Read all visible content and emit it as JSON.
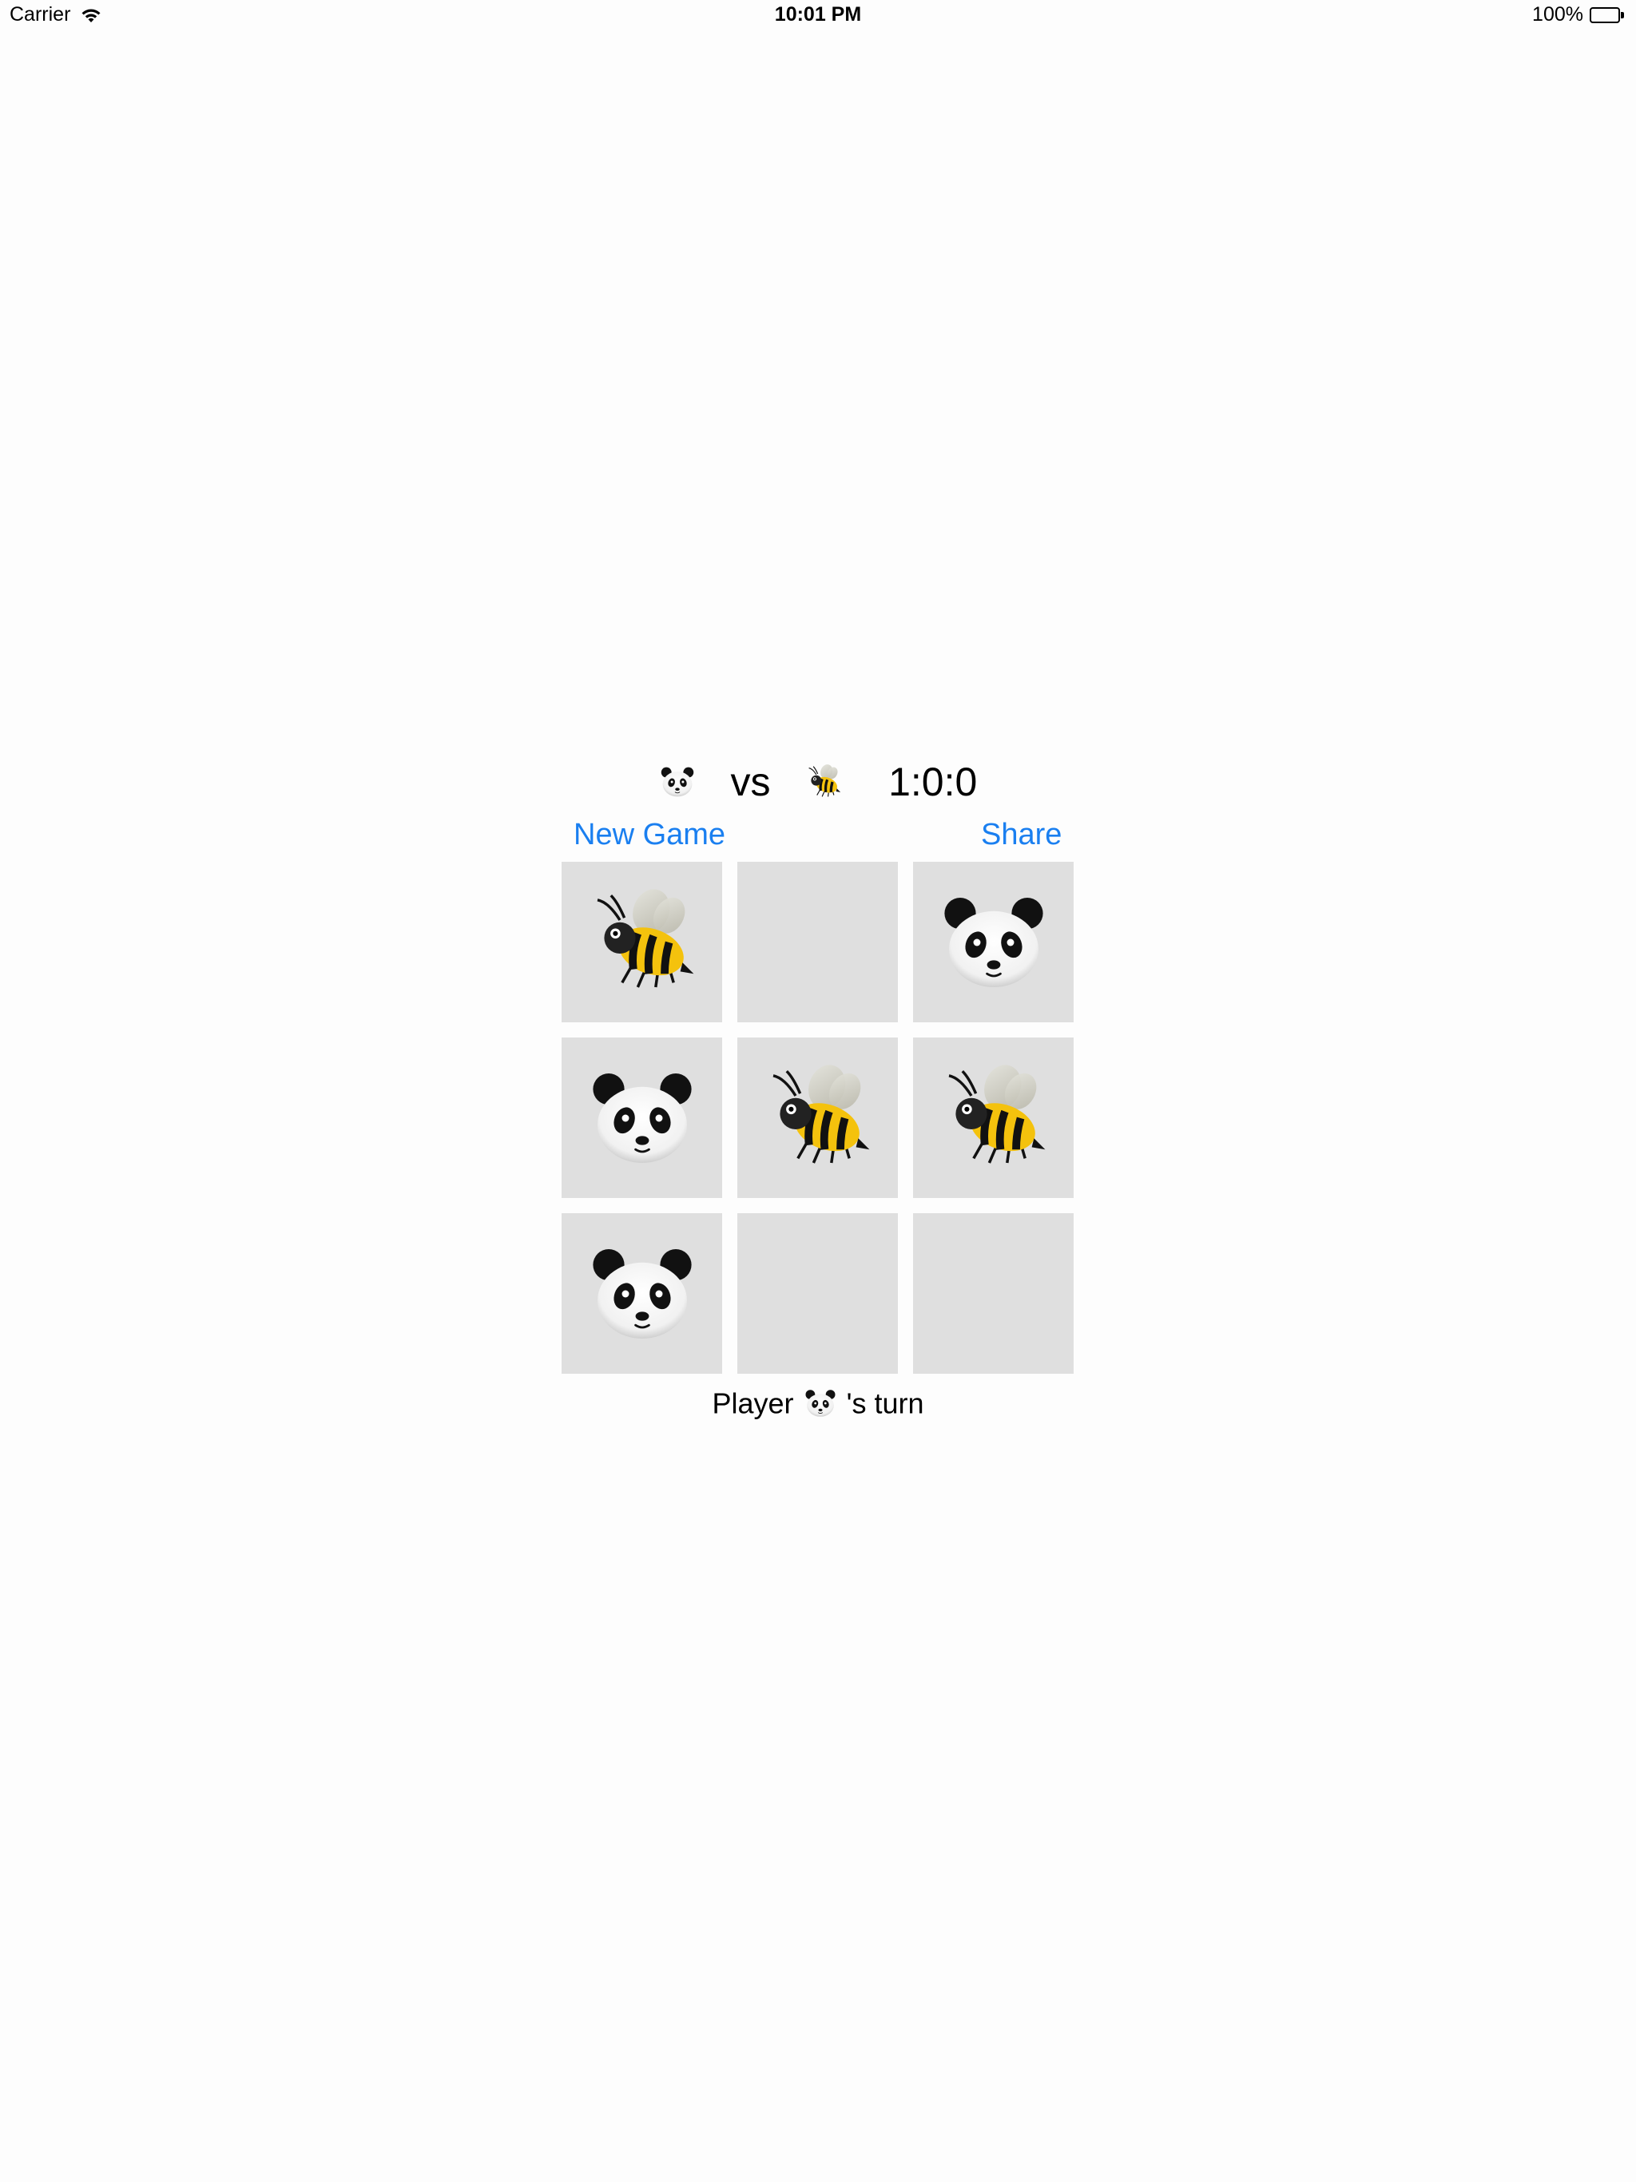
{
  "status_bar": {
    "carrier": "Carrier",
    "time": "10:01 PM",
    "battery": "100%"
  },
  "score": {
    "player1_icon": "panda-icon",
    "vs": "vs",
    "player2_icon": "bee-icon",
    "tally": "1:0:0"
  },
  "buttons": {
    "new_game": "New Game",
    "share": "Share"
  },
  "board": [
    [
      "bee",
      "",
      "panda"
    ],
    [
      "panda",
      "bee",
      "bee"
    ],
    [
      "panda",
      "",
      ""
    ]
  ],
  "turn": {
    "prefix": "Player",
    "player_icon": "panda-icon",
    "suffix": "'s turn"
  },
  "colors": {
    "accent": "#1a7ff0",
    "cell_background": "#dfdfdf",
    "page_background": "#fdfdfd"
  }
}
